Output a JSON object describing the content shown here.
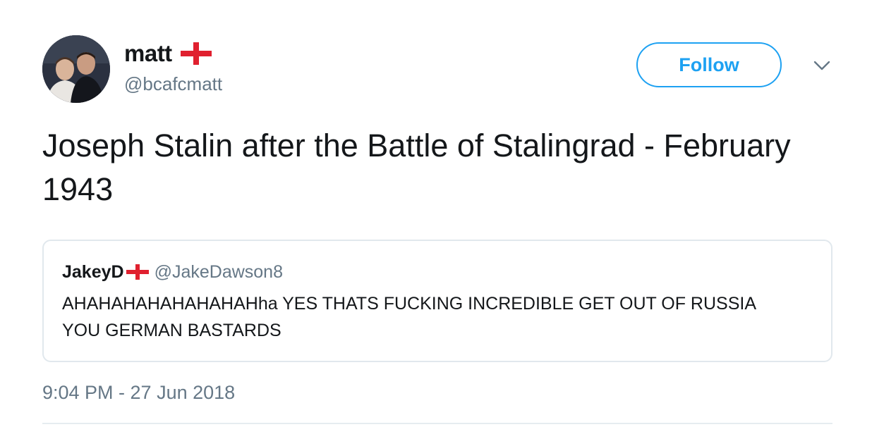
{
  "author": {
    "display_name": "matt",
    "handle": "@bcafcmatt",
    "flag_icon": "england-flag-icon"
  },
  "follow_button": {
    "label": "Follow"
  },
  "menu": {
    "icon": "chevron-down-icon"
  },
  "tweet": {
    "text": "Joseph Stalin after the Battle of Stalingrad - February 1943",
    "timestamp": "9:04 PM - 27 Jun 2018"
  },
  "quoted_tweet": {
    "display_name": "JakeyD",
    "handle": "@JakeDawson8",
    "flag_icon": "england-flag-icon",
    "text": "AHAHAHAHAHAHAHAHha YES THATS FUCKING INCREDIBLE GET OUT OF RUSSIA YOU GERMAN BASTARDS"
  },
  "colors": {
    "accent": "#1da1f2",
    "text_primary": "#14171a",
    "text_secondary": "#657786",
    "border": "#e1e8ed",
    "flag_red": "#e0202f"
  }
}
